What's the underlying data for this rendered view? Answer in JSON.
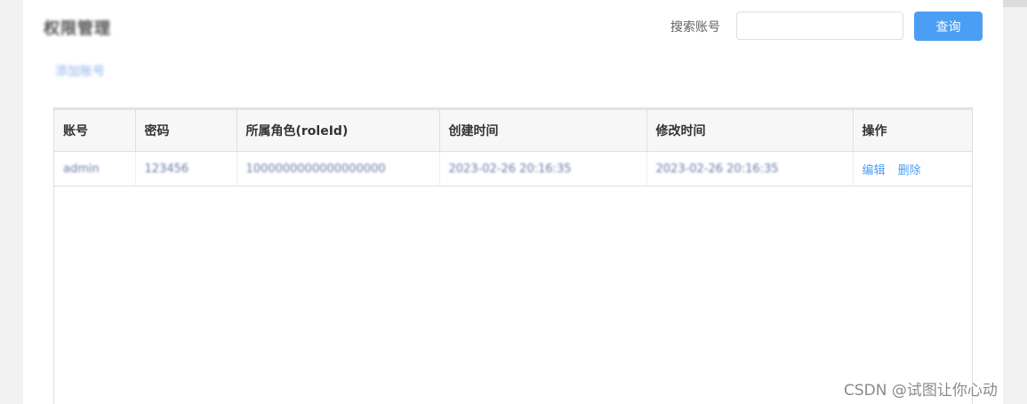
{
  "header": {
    "title": "权限管理",
    "subtitle": "添加账号"
  },
  "search": {
    "label": "搜索账号",
    "value": "",
    "placeholder": "",
    "button_label": "查询"
  },
  "table": {
    "columns": [
      "账号",
      "密码",
      "所属角色(roleId)",
      "创建时间",
      "修改时间",
      "操作"
    ],
    "rows": [
      {
        "account": "admin",
        "password": "123456",
        "role": "1000000000000000000",
        "created": "2023-02-26 20:16:35",
        "modified": "2023-02-26 20:16:35",
        "edit_label": "编辑",
        "delete_label": "删除"
      }
    ]
  },
  "watermark": "CSDN @试图让你心动",
  "colors": {
    "accent": "#4a9ff5",
    "page_bg": "#f2f2f2",
    "header_bg": "#f7f7f7",
    "border": "#dcdfe6"
  }
}
